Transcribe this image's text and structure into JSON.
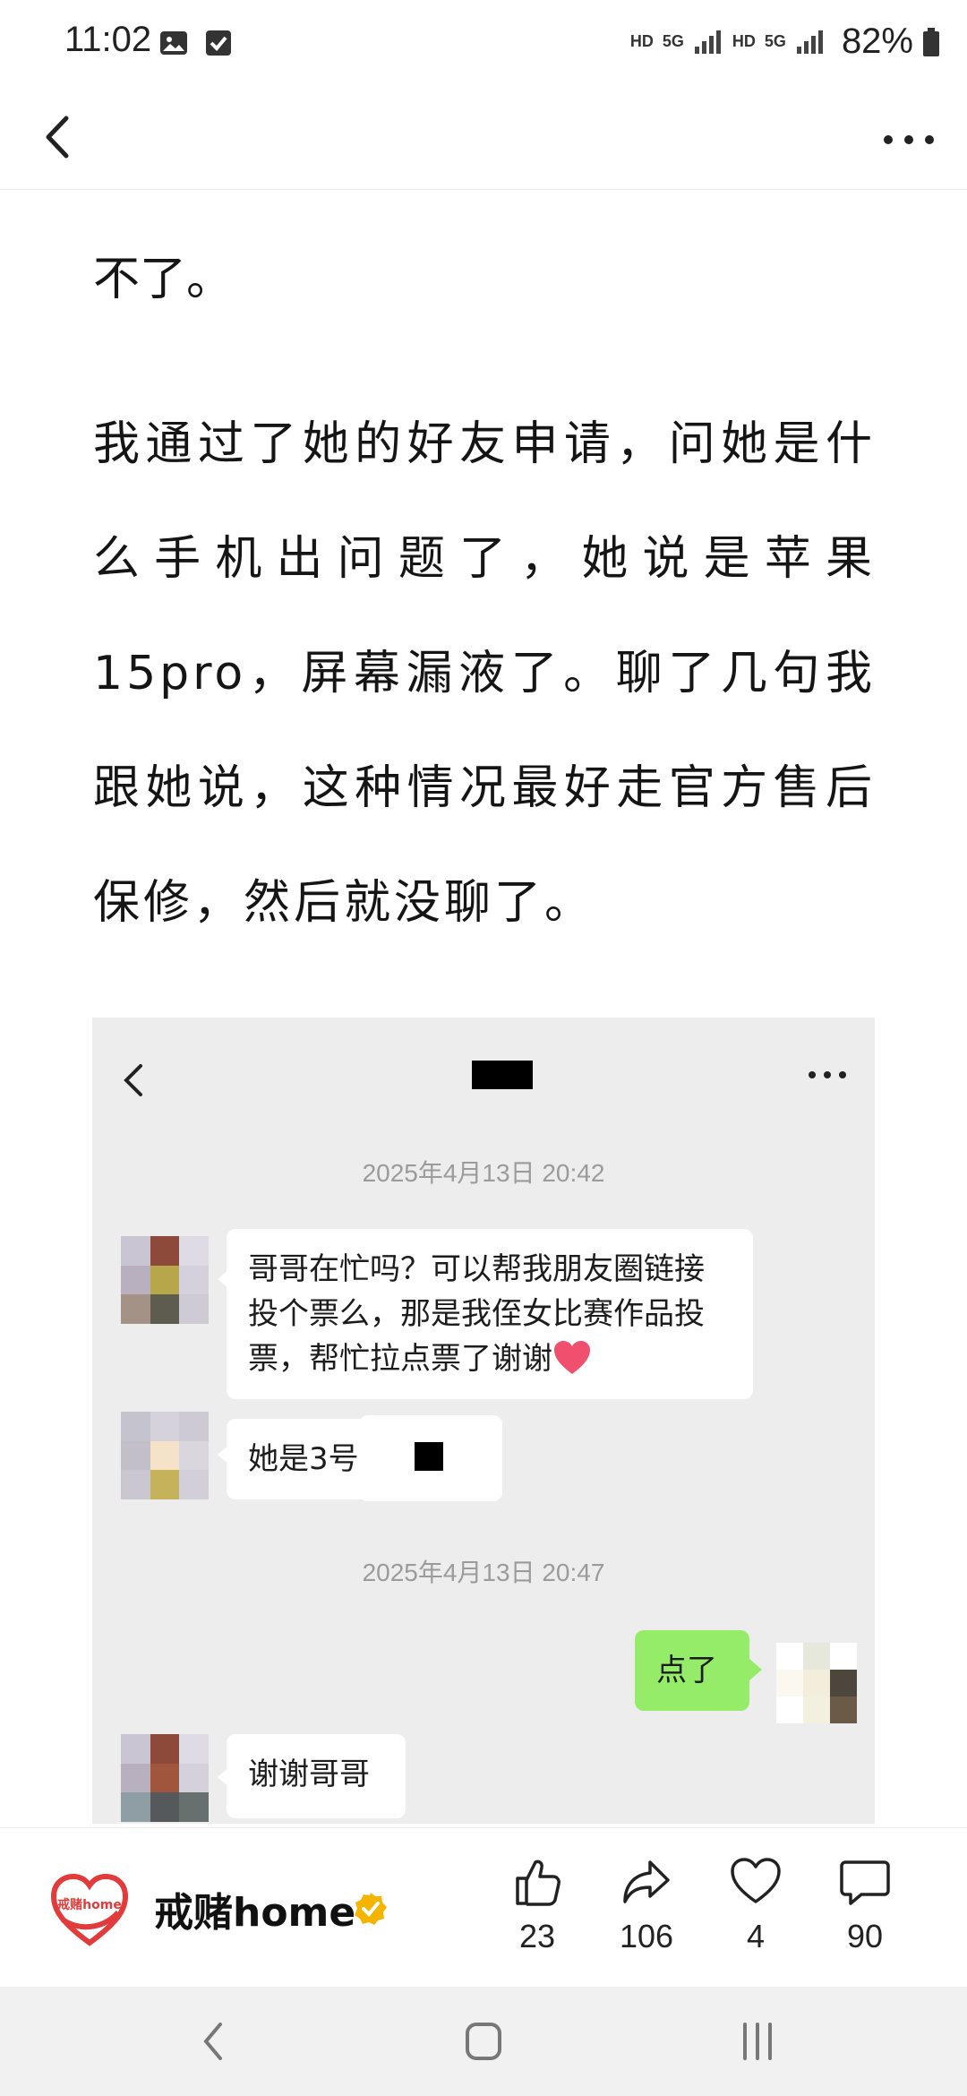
{
  "status_bar": {
    "time": "11:02",
    "signal_labels": [
      "HD",
      "5G",
      "HD",
      "5G"
    ],
    "battery": "82%"
  },
  "article": {
    "para1": "不了。",
    "para2": "我通过了她的好友申请，问她是什么手机出问题了，她说是苹果15pro，屏幕漏液了。聊了几句我跟她说，这种情况最好走官方售后保修，然后就没聊了。"
  },
  "chat": {
    "timestamp_1": "2025年4月13日 20:42",
    "msg_1": "哥哥在忙吗？可以帮我朋友圈链接投个票么，那是我侄女比赛作品投票，帮忙拉点票了谢谢",
    "msg_2": "她是3号",
    "timestamp_2": "2025年4月13日 20:47",
    "msg_3": "点了",
    "msg_4": "谢谢哥哥"
  },
  "author": {
    "name": "戒赌home",
    "logo_text": "戒赌home"
  },
  "actions": {
    "like_count": "23",
    "share_count": "106",
    "favorite_count": "4",
    "comment_count": "90"
  },
  "colors": {
    "accent_red": "#e23b3b",
    "chat_bg": "#ededed",
    "self_bubble": "#95ec69",
    "verified_gold": "#f5b400"
  },
  "icons": [
    "back-arrow-icon",
    "more-dots-icon",
    "thumbs-up-icon",
    "share-icon",
    "heart-icon",
    "comment-icon",
    "verified-icon"
  ]
}
